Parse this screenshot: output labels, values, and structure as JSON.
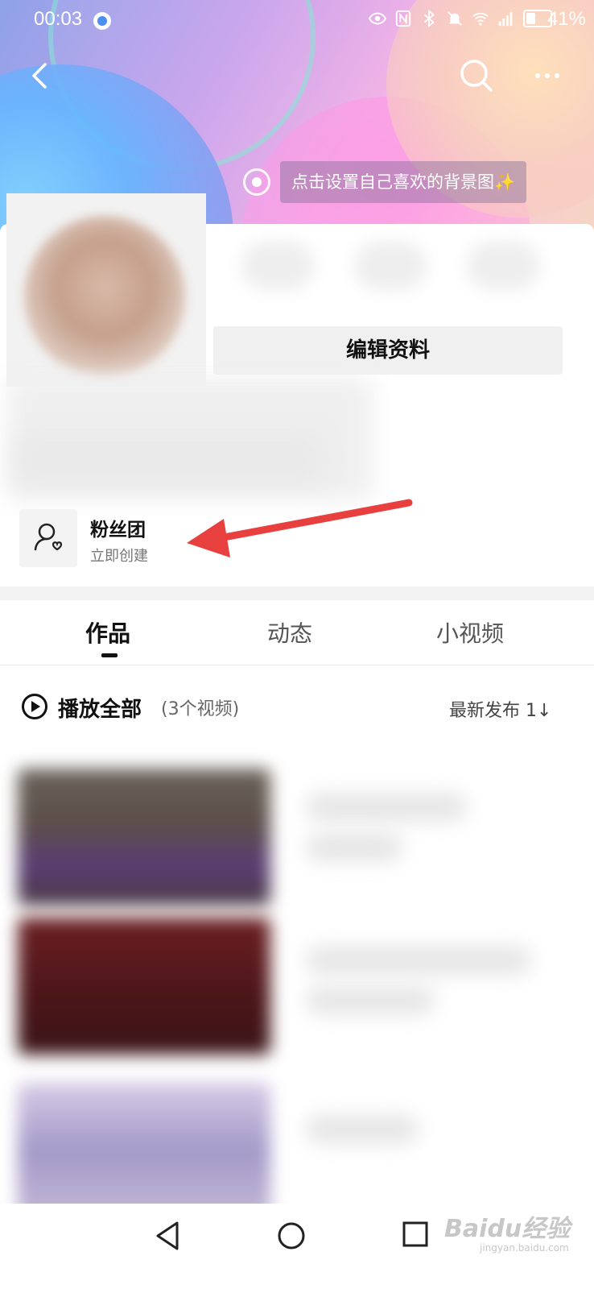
{
  "status_bar": {
    "time": "00:03",
    "battery_pct": "41%",
    "battery_level": 0.41
  },
  "header": {
    "bg_tip": "点击设置自己喜欢的背景图✨"
  },
  "profile": {
    "edit_button": "编辑资料"
  },
  "fans_club": {
    "title": "粉丝团",
    "subtitle": "立即创建"
  },
  "tabs": [
    {
      "label": "作品",
      "active": true
    },
    {
      "label": "动态",
      "active": false
    },
    {
      "label": "小视频",
      "active": false
    }
  ],
  "play_all": {
    "label": "播放全部",
    "count": "(3个视频)",
    "sort": "最新发布 1↓"
  },
  "watermark": {
    "brand": "Baidu经验",
    "url": "jingyan.baidu.com"
  },
  "colors": {
    "arrow": "#e8403f",
    "accent": "#111111"
  }
}
